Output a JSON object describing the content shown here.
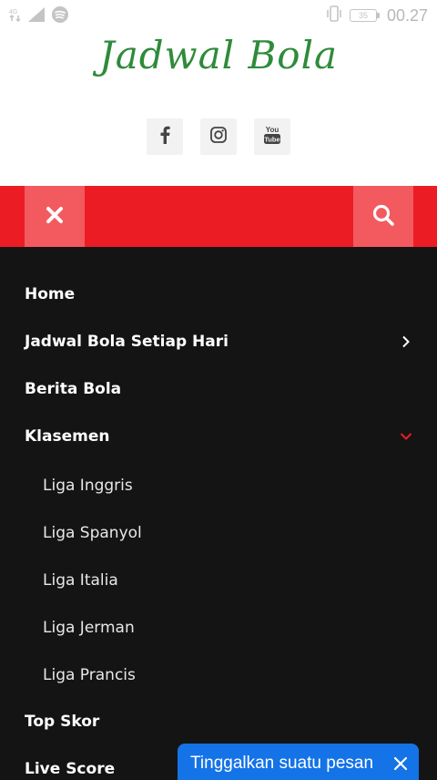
{
  "status_bar": {
    "time": "00.27",
    "battery": "35",
    "icons": [
      "data-icon",
      "signal-icon",
      "spotify-icon",
      "vibrate-icon",
      "battery-icon"
    ]
  },
  "header": {
    "title": "Jadwal Bola",
    "title_color": "#2e8b3a",
    "social": [
      {
        "icon": "facebook-icon"
      },
      {
        "icon": "instagram-icon"
      },
      {
        "icon": "youtube-icon",
        "text_top": "You",
        "text_bottom": "Tube"
      }
    ]
  },
  "navbar": {
    "color": "#ec1c24",
    "button_color": "#f25a5f",
    "close_icon": "close-icon",
    "search_icon": "search-icon"
  },
  "menu": {
    "background": "#141414",
    "items": [
      {
        "label": "Home"
      },
      {
        "label": "Jadwal Bola Setiap Hari",
        "chevron": "right"
      },
      {
        "label": "Berita Bola"
      },
      {
        "label": "Klasemen",
        "chevron": "down",
        "expanded": true,
        "children": [
          {
            "label": "Liga Inggris"
          },
          {
            "label": "Liga Spanyol"
          },
          {
            "label": "Liga Italia"
          },
          {
            "label": "Liga Jerman"
          },
          {
            "label": "Liga Prancis"
          }
        ]
      },
      {
        "label": "Top Skor"
      },
      {
        "label": "Live Score"
      }
    ]
  },
  "chat_widget": {
    "label": "Tinggalkan suatu pesan",
    "color": "#1473e6"
  }
}
